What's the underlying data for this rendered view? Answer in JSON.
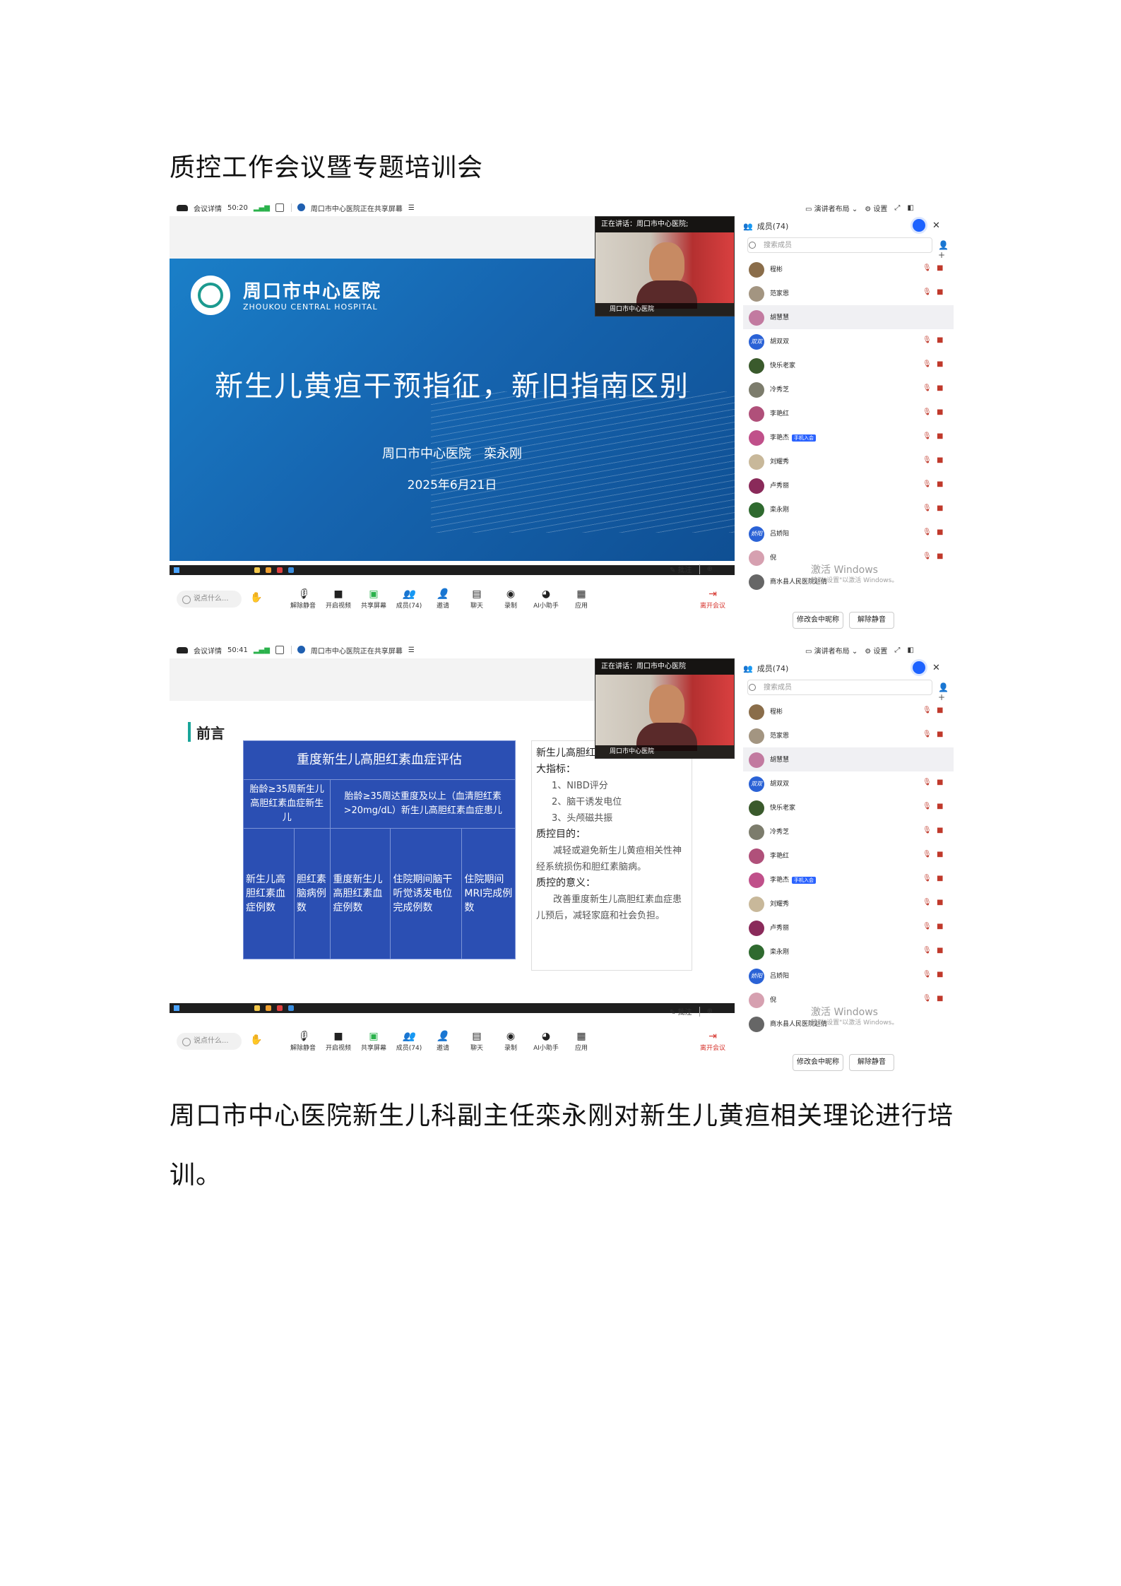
{
  "document": {
    "title": "质控工作会议暨专题培训会",
    "caption": "周口市中心医院新生儿科副主任栾永刚对新生儿黄疸相关理论进行培训。"
  },
  "colors": {
    "accent_blue": "#1c62ff",
    "slide_blue": "#1665b0",
    "table_blue": "#2b4fb3",
    "leave_red": "#d6332c"
  },
  "shots": [
    {
      "topbar": {
        "details": "会议详情",
        "time": "50:20",
        "sharing": "周口市中心医院正在共享屏幕",
        "layout": "演讲者布局",
        "settings": "设置"
      },
      "video": {
        "speaking": "正在讲话：周口市中心医院;",
        "name": "周口市中心医院"
      },
      "annotate": "批注",
      "toolbar": {
        "say": "说点什么...",
        "unmute": "解除静音",
        "video": "开启视频",
        "share": "共享屏幕",
        "members": "成员(74)",
        "invite": "邀请",
        "chat": "聊天",
        "record": "录制",
        "ai": "AI小助手",
        "apps": "应用",
        "leave": "离开会议"
      },
      "panel": {
        "title": "成员(74)",
        "search": "搜索成员",
        "members": [
          {
            "name": "程彬",
            "color": "#8a6d4a",
            "label": "",
            "badge": ""
          },
          {
            "name": "范家恩",
            "color": "#a39581",
            "label": "",
            "badge": ""
          },
          {
            "name": "胡慧慧",
            "color": "#c27aa0",
            "label": "",
            "badge": ""
          },
          {
            "name": "胡双双",
            "color": "#2a62d6",
            "label": "双双",
            "badge": ""
          },
          {
            "name": "快乐老家",
            "color": "#3a5a2c",
            "label": "",
            "badge": ""
          },
          {
            "name": "冷秀芝",
            "color": "#7c7c6c",
            "label": "",
            "badge": ""
          },
          {
            "name": "李艳红",
            "color": "#b0507a",
            "label": "",
            "badge": ""
          },
          {
            "name": "李艳杰",
            "color": "#c0508a",
            "label": "",
            "badge": "手机入会"
          },
          {
            "name": "刘耀秀",
            "color": "#c8b89a",
            "label": "",
            "badge": ""
          },
          {
            "name": "卢秀丽",
            "color": "#8a2a5a",
            "label": "",
            "badge": ""
          },
          {
            "name": "栾永刚",
            "color": "#2f6a2f",
            "label": "",
            "badge": ""
          },
          {
            "name": "吕娇阳",
            "color": "#2a62d6",
            "label": "娇阳",
            "badge": ""
          },
          {
            "name": "倪",
            "color": "#d6a0b0",
            "label": "",
            "badge": ""
          },
          {
            "name": "商水县人民医院赵倩",
            "color": "#666666",
            "label": "",
            "badge": ""
          }
        ],
        "activate_title": "激活 Windows",
        "activate_sub": "转到\"设置\"以激活 Windows。",
        "rename": "修改会中昵称",
        "unmute_all": "解除静音"
      },
      "slide": {
        "hospital_cn": "周口市中心医院",
        "hospital_en": "ZHOUKOU CENTRAL HOSPITAL",
        "title": "新生儿黄疸干预指征，新旧指南区别",
        "presenter": "周口市中心医院　栾永刚",
        "date": "2025年6月21日"
      }
    },
    {
      "topbar": {
        "details": "会议详情",
        "time": "50:41",
        "sharing": "周口市中心医院正在共享屏幕",
        "layout": "演讲者布局",
        "settings": "设置"
      },
      "video": {
        "speaking": "正在讲话：周口市中心医院",
        "name": "周口市中心医院"
      },
      "annotate": "批注",
      "toolbar": {
        "say": "说点什么...",
        "unmute": "解除静音",
        "video": "开启视频",
        "share": "共享屏幕",
        "members": "成员(74)",
        "invite": "邀请",
        "chat": "聊天",
        "record": "录制",
        "ai": "AI小助手",
        "apps": "应用",
        "leave": "离开会议"
      },
      "panel": {
        "title": "成员(74)",
        "search": "搜索成员",
        "members": [
          {
            "name": "程彬",
            "color": "#8a6d4a",
            "label": "",
            "badge": ""
          },
          {
            "name": "范家恩",
            "color": "#a39581",
            "label": "",
            "badge": ""
          },
          {
            "name": "胡慧慧",
            "color": "#c27aa0",
            "label": "",
            "badge": ""
          },
          {
            "name": "胡双双",
            "color": "#2a62d6",
            "label": "双双",
            "badge": ""
          },
          {
            "name": "快乐老家",
            "color": "#3a5a2c",
            "label": "",
            "badge": ""
          },
          {
            "name": "冷秀芝",
            "color": "#7c7c6c",
            "label": "",
            "badge": ""
          },
          {
            "name": "李艳红",
            "color": "#b0507a",
            "label": "",
            "badge": ""
          },
          {
            "name": "李艳杰",
            "color": "#c0508a",
            "label": "",
            "badge": "手机入会"
          },
          {
            "name": "刘耀秀",
            "color": "#c8b89a",
            "label": "",
            "badge": ""
          },
          {
            "name": "卢秀丽",
            "color": "#8a2a5a",
            "label": "",
            "badge": ""
          },
          {
            "name": "栾永刚",
            "color": "#2f6a2f",
            "label": "",
            "badge": ""
          },
          {
            "name": "吕娇阳",
            "color": "#2a62d6",
            "label": "娇阳",
            "badge": ""
          },
          {
            "name": "倪",
            "color": "#d6a0b0",
            "label": "",
            "badge": ""
          },
          {
            "name": "商水县人民医院赵倩",
            "color": "#666666",
            "label": "",
            "badge": ""
          }
        ],
        "activate_title": "激活 Windows",
        "activate_sub": "转到\"设置\"以激活 Windows。",
        "rename": "修改会中昵称",
        "unmute_all": "解除静音"
      },
      "slide": {
        "heading": "前言",
        "table_title": "重度新生儿高胆红素血症评估",
        "sub1": "胎龄≥35周新生儿高胆红素血症新生儿",
        "sub2": "胎龄≥35周达重度及以上（血清胆红素>20mg/dL）新生儿高胆红素血症患儿",
        "cols": [
          "新生儿高胆红素血症例数",
          "胆红素脑病例数",
          "重度新生儿高胆红素血症例数",
          "住院期间脑干听觉诱发电位完成例数",
          "住院期间MRI完成例数"
        ],
        "notes": {
          "head1": "新生儿高胆红素血症必须关注的3大指标：",
          "items": [
            "1、NIBD评分",
            "2、脑干诱发电位",
            "3、头颅磁共振"
          ],
          "head2": "质控目的：",
          "p1": "减轻或避免新生儿黄疸相关性神经系统损伤和胆红素脑病。",
          "head3": "质控的意义：",
          "p2": "改善重度新生儿高胆红素血症患儿预后，减轻家庭和社会负担。"
        }
      }
    }
  ]
}
